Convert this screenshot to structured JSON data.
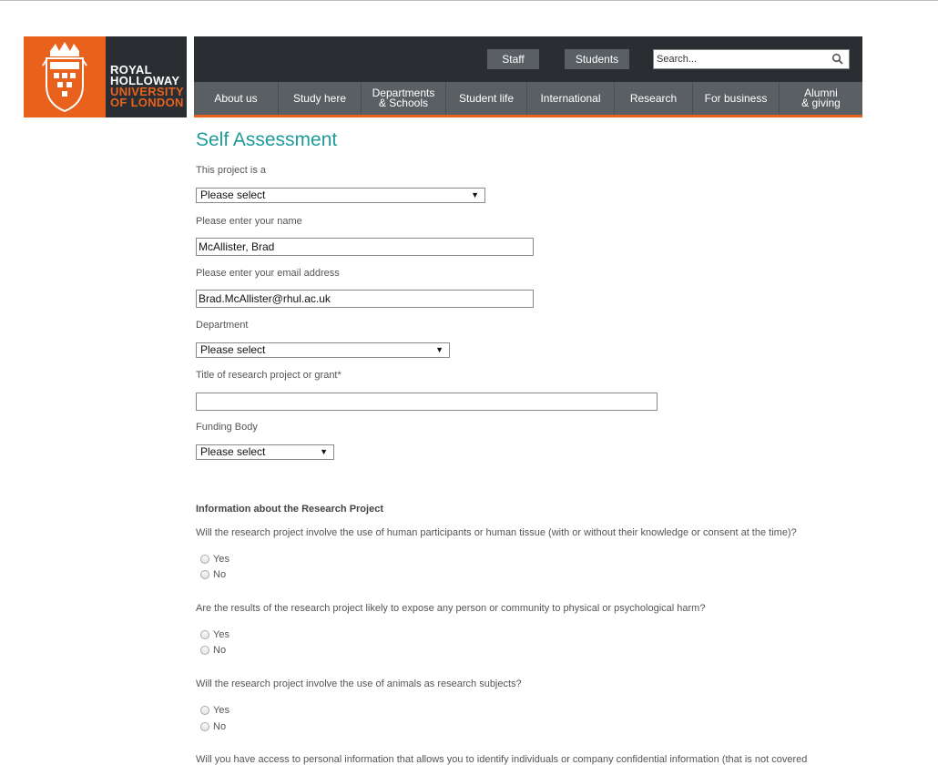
{
  "logo": {
    "line1": "ROYAL",
    "line2": "HOLLOWAY",
    "line3": "UNIVERSITY",
    "line4": "OF LONDON"
  },
  "header": {
    "staff_label": "Staff",
    "students_label": "Students",
    "search_placeholder": "Search...",
    "nav": [
      {
        "label": "About us"
      },
      {
        "label": "Study here"
      },
      {
        "label": "Departments\n& Schools"
      },
      {
        "label": "Student life"
      },
      {
        "label": "International"
      },
      {
        "label": "Research"
      },
      {
        "label": "For business"
      },
      {
        "label": "Alumni\n& giving"
      }
    ]
  },
  "form": {
    "title": "Self Assessment",
    "project_type": {
      "label": "This project is a",
      "value": "Please select"
    },
    "name": {
      "label": "Please enter your name",
      "value": "McAllister, Brad"
    },
    "email": {
      "label": "Please enter your email address",
      "value": "Brad.McAllister@rhul.ac.uk"
    },
    "department": {
      "label": "Department",
      "value": "Please select"
    },
    "title_field": {
      "label": "Title of research project or grant*",
      "value": ""
    },
    "funding": {
      "label": "Funding Body",
      "value": "Please select"
    }
  },
  "research_info": {
    "heading": "Information about the Research Project",
    "questions": [
      {
        "text": "Will the research project involve the use of human participants or human tissue (with or without their knowledge or consent at the time)?",
        "options": [
          "Yes",
          "No"
        ]
      },
      {
        "text": "Are the results of the research project likely to expose any person or community to physical or psychological harm?",
        "options": [
          "Yes",
          "No"
        ]
      },
      {
        "text": "Will the research project involve the use of animals as research subjects?",
        "options": [
          "Yes",
          "No"
        ]
      },
      {
        "text": "Will you have access to personal information that allows you to identify individuals or company confidential information (that is not covered"
      }
    ]
  },
  "colors": {
    "brand_orange": "#e8611d",
    "header_dark": "#2a2e33",
    "nav_grey": "#5a5f64",
    "title_teal": "#1e9a9c"
  }
}
